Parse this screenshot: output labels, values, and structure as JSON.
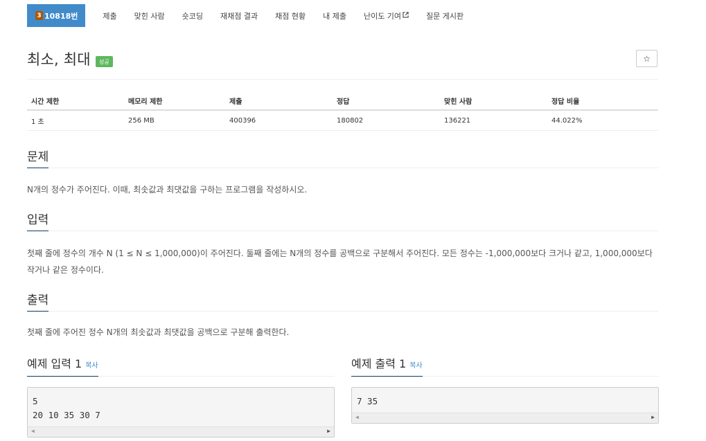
{
  "nav": {
    "tier": "3",
    "problem_id": "10818번",
    "items": [
      "제출",
      "맞힌 사람",
      "숏코딩",
      "재채점 결과",
      "채점 현황",
      "내 제출",
      "난이도 기여",
      "질문 게시판"
    ]
  },
  "title": "최소, 최대",
  "result_badge": "성공",
  "star_glyph": "☆",
  "stats": {
    "headers": [
      "시간 제한",
      "메모리 제한",
      "제출",
      "정답",
      "맞힌 사람",
      "정답 비율"
    ],
    "values": [
      "1 초",
      "256 MB",
      "400396",
      "180802",
      "136221",
      "44.022%"
    ]
  },
  "sections": {
    "problem": {
      "title": "문제",
      "text": "N개의 정수가 주어진다. 이때, 최솟값과 최댓값을 구하는 프로그램을 작성하시오."
    },
    "input": {
      "title": "입력",
      "text": "첫째 줄에 정수의 개수 N (1 ≤ N ≤ 1,000,000)이 주어진다. 둘째 줄에는 N개의 정수를 공백으로 구분해서 주어진다. 모든 정수는 -1,000,000보다 크거나 같고, 1,000,000보다 작거나 같은 정수이다."
    },
    "output": {
      "title": "출력",
      "text": "첫째 줄에 주어진 정수 N개의 최솟값과 최댓값을 공백으로 구분해 출력한다."
    }
  },
  "samples": {
    "input": {
      "title": "예제 입력 1",
      "copy": "복사",
      "lines": [
        "5",
        "20 10 35 30 7"
      ]
    },
    "output": {
      "title": "예제 출력 1",
      "copy": "복사",
      "lines": [
        "7 35"
      ]
    }
  },
  "colors": {
    "nav_active": "#428bca",
    "tier_bronze": "#ad5600",
    "success": "#5cb85c",
    "link": "#428bca",
    "section_underline": "#0d3a5f"
  }
}
